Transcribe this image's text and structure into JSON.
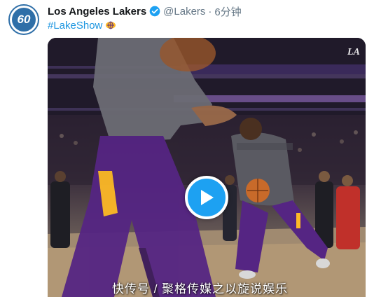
{
  "account": {
    "avatar_text": "60",
    "display_name": "Los Angeles Lakers",
    "handle": "@Lakers",
    "separator": "·",
    "time": "6分钟"
  },
  "tweet": {
    "hashtag": "#LakeShow"
  },
  "video": {
    "watermark": "快传号 / 聚格传媒之以旋说娱乐",
    "play_icon": "play-icon"
  },
  "colors": {
    "link_blue": "#1b95e0",
    "verified_blue": "#1da1f2",
    "lakers_purple": "#552583",
    "lakers_gold": "#fdb927"
  }
}
